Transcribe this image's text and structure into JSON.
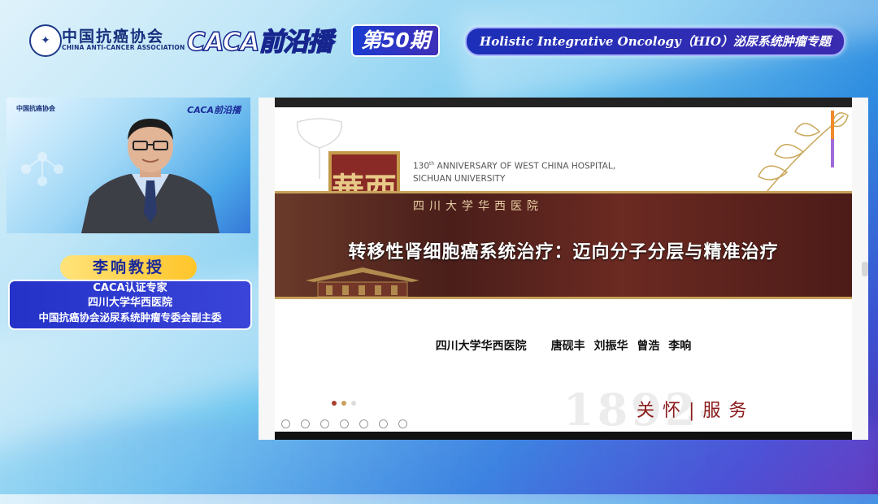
{
  "header": {
    "org_name_cn": "中国抗癌协会",
    "org_name_en": "CHINA ANTI-CANCER ASSOCIATION",
    "brand": "CACA前沿播",
    "episode": "第50期",
    "topic": "Holistic Integrative Oncology（HIO）泌尿系统肿瘤专题"
  },
  "video": {
    "mini_logo": "中国抗癌协会",
    "mini_brand": "CACA前沿播"
  },
  "speaker": {
    "name": "李响教授",
    "credentials": [
      "CACA认证专家",
      "四川大学华西医院",
      "中国抗癌协会泌尿系统肿瘤专委会副主委"
    ]
  },
  "slide": {
    "seal_text": "華西",
    "anniversary_number": "130",
    "anniversary_suffix": "th",
    "anniversary_line1": " ANNIVERSARY OF WEST CHINA HOSPITAL,",
    "anniversary_line2": "SICHUAN UNIVERSITY",
    "university_cn": "四川大学华西医院",
    "title": "转移性肾细胞癌系统治疗：迈向分子分层与精准治疗",
    "institution": "四川大学华西医院",
    "authors": "唐砚丰  刘振华  曾浩  李响",
    "watermark_year": "1892-2022",
    "motto": "关怀|服务"
  },
  "colors": {
    "brand_blue": "#17268f",
    "plate_gold": "#ffc52a",
    "banner_maroon": "#4a1e1a",
    "motto_red": "#8b1a1a"
  }
}
